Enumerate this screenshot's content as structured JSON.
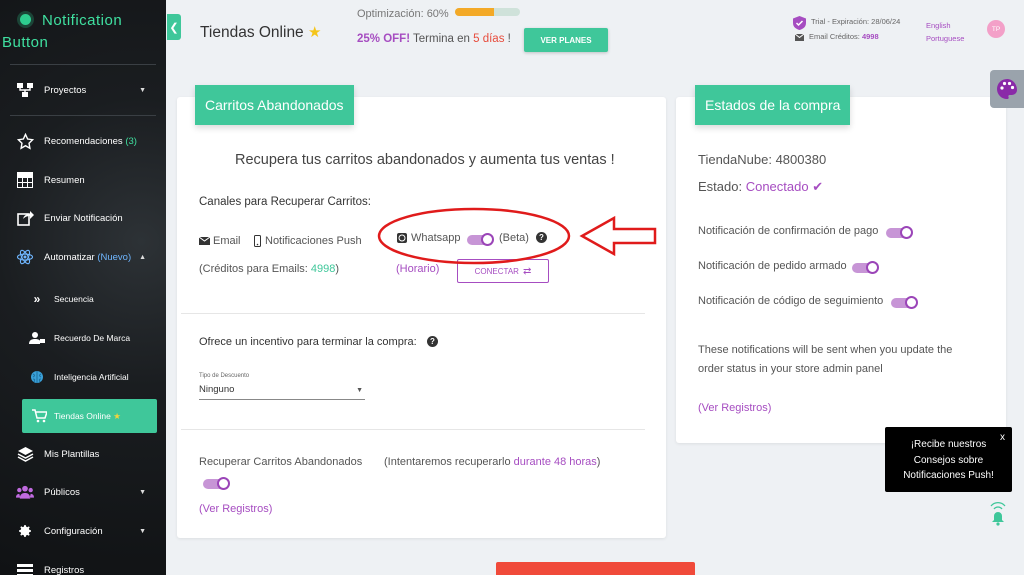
{
  "app": {
    "name_line1": "Notification",
    "name_line2": "Button"
  },
  "sidebar": {
    "items": [
      {
        "label": "Proyectos",
        "icon": "project-diagram-icon"
      },
      {
        "label": "Recomendaciones",
        "badge": "(3)",
        "icon": "star-icon"
      },
      {
        "label": "Resumen",
        "icon": "table-icon"
      },
      {
        "label": "Enviar Notificación",
        "icon": "share-icon"
      },
      {
        "label": "Automatizar",
        "badge": "(Nuevo)",
        "icon": "atom-icon"
      },
      {
        "label": "Secuencia",
        "icon": "double-chevron-icon"
      },
      {
        "label": "Recuerdo De Marca",
        "icon": "user-tag-icon"
      },
      {
        "label": "Inteligencia Artificial",
        "icon": "brain-icon"
      },
      {
        "label": "Tiendas Online",
        "icon": "cart-icon"
      },
      {
        "label": "Mis Plantillas",
        "icon": "layers-icon"
      },
      {
        "label": "Públicos",
        "icon": "users-icon"
      },
      {
        "label": "Configuración",
        "icon": "gear-icon"
      },
      {
        "label": "Registros",
        "icon": "list-icon"
      }
    ]
  },
  "header": {
    "title": "Tiendas Online",
    "optimization_label": "Optimización: 60%",
    "optimization_progress": 0.6,
    "promo_discount": "25% OFF!",
    "promo_text": " Termina en ",
    "promo_days": "5 días",
    "promo_suffix": " !",
    "plans_button": "VER PLANES",
    "trial": "Trial - Expiración: 28/06/24",
    "credits_label": "Email Créditos: ",
    "credits_value": "4998",
    "lang_en": "English",
    "lang_pt": "Portuguese",
    "avatar": "TP"
  },
  "carts": {
    "title": "Carritos Abandonados",
    "headline": "Recupera tus carritos abandonados y aumenta tus ventas !",
    "channels_label": "Canales para Recuperar Carritos:",
    "email": "Email",
    "push": "Notificaciones Push",
    "whatsapp": "Whatsapp",
    "beta": "(Beta)",
    "credits_prefix": "(Créditos para Emails: ",
    "credits_value": "4998",
    "credits_suffix": ")",
    "schedule_link": "(Horario)",
    "connect_button": "CONECTAR",
    "incentive_label": "Ofrece un incentivo para terminar la compra:",
    "discount_type_label": "Tipo de Descuento",
    "discount_type_value": "Ninguno",
    "recover_label": "Recuperar Carritos Abandonados",
    "recover_note_prefix": "(Intentaremos recuperarlo ",
    "recover_note_highlight": "durante 48 horas",
    "recover_note_suffix": ")",
    "logs_link": "(Ver Registros)"
  },
  "purchase": {
    "title": "Estados de la compra",
    "store": "TiendaNube: 4800380",
    "status_label": "Estado: ",
    "status_value": "Conectado",
    "notif_payment": "Notificación de confirmación de pago",
    "notif_packed": "Notificación de pedido armado",
    "notif_tracking": "Notificación de código de seguimiento",
    "info_line1": "These notifications will be sent when you update the",
    "info_line2": "order status in your store admin panel",
    "logs_link": "(Ver Registros)"
  },
  "tooltip": {
    "line1": "¡Recibe nuestros",
    "line2": "Consejos sobre",
    "line3": "Notificaciones Push!",
    "close": "x"
  },
  "colors": {
    "accent": "#3fc79a",
    "purple": "#a64dc1",
    "red": "#e01b1b",
    "orange": "#f3a927"
  }
}
